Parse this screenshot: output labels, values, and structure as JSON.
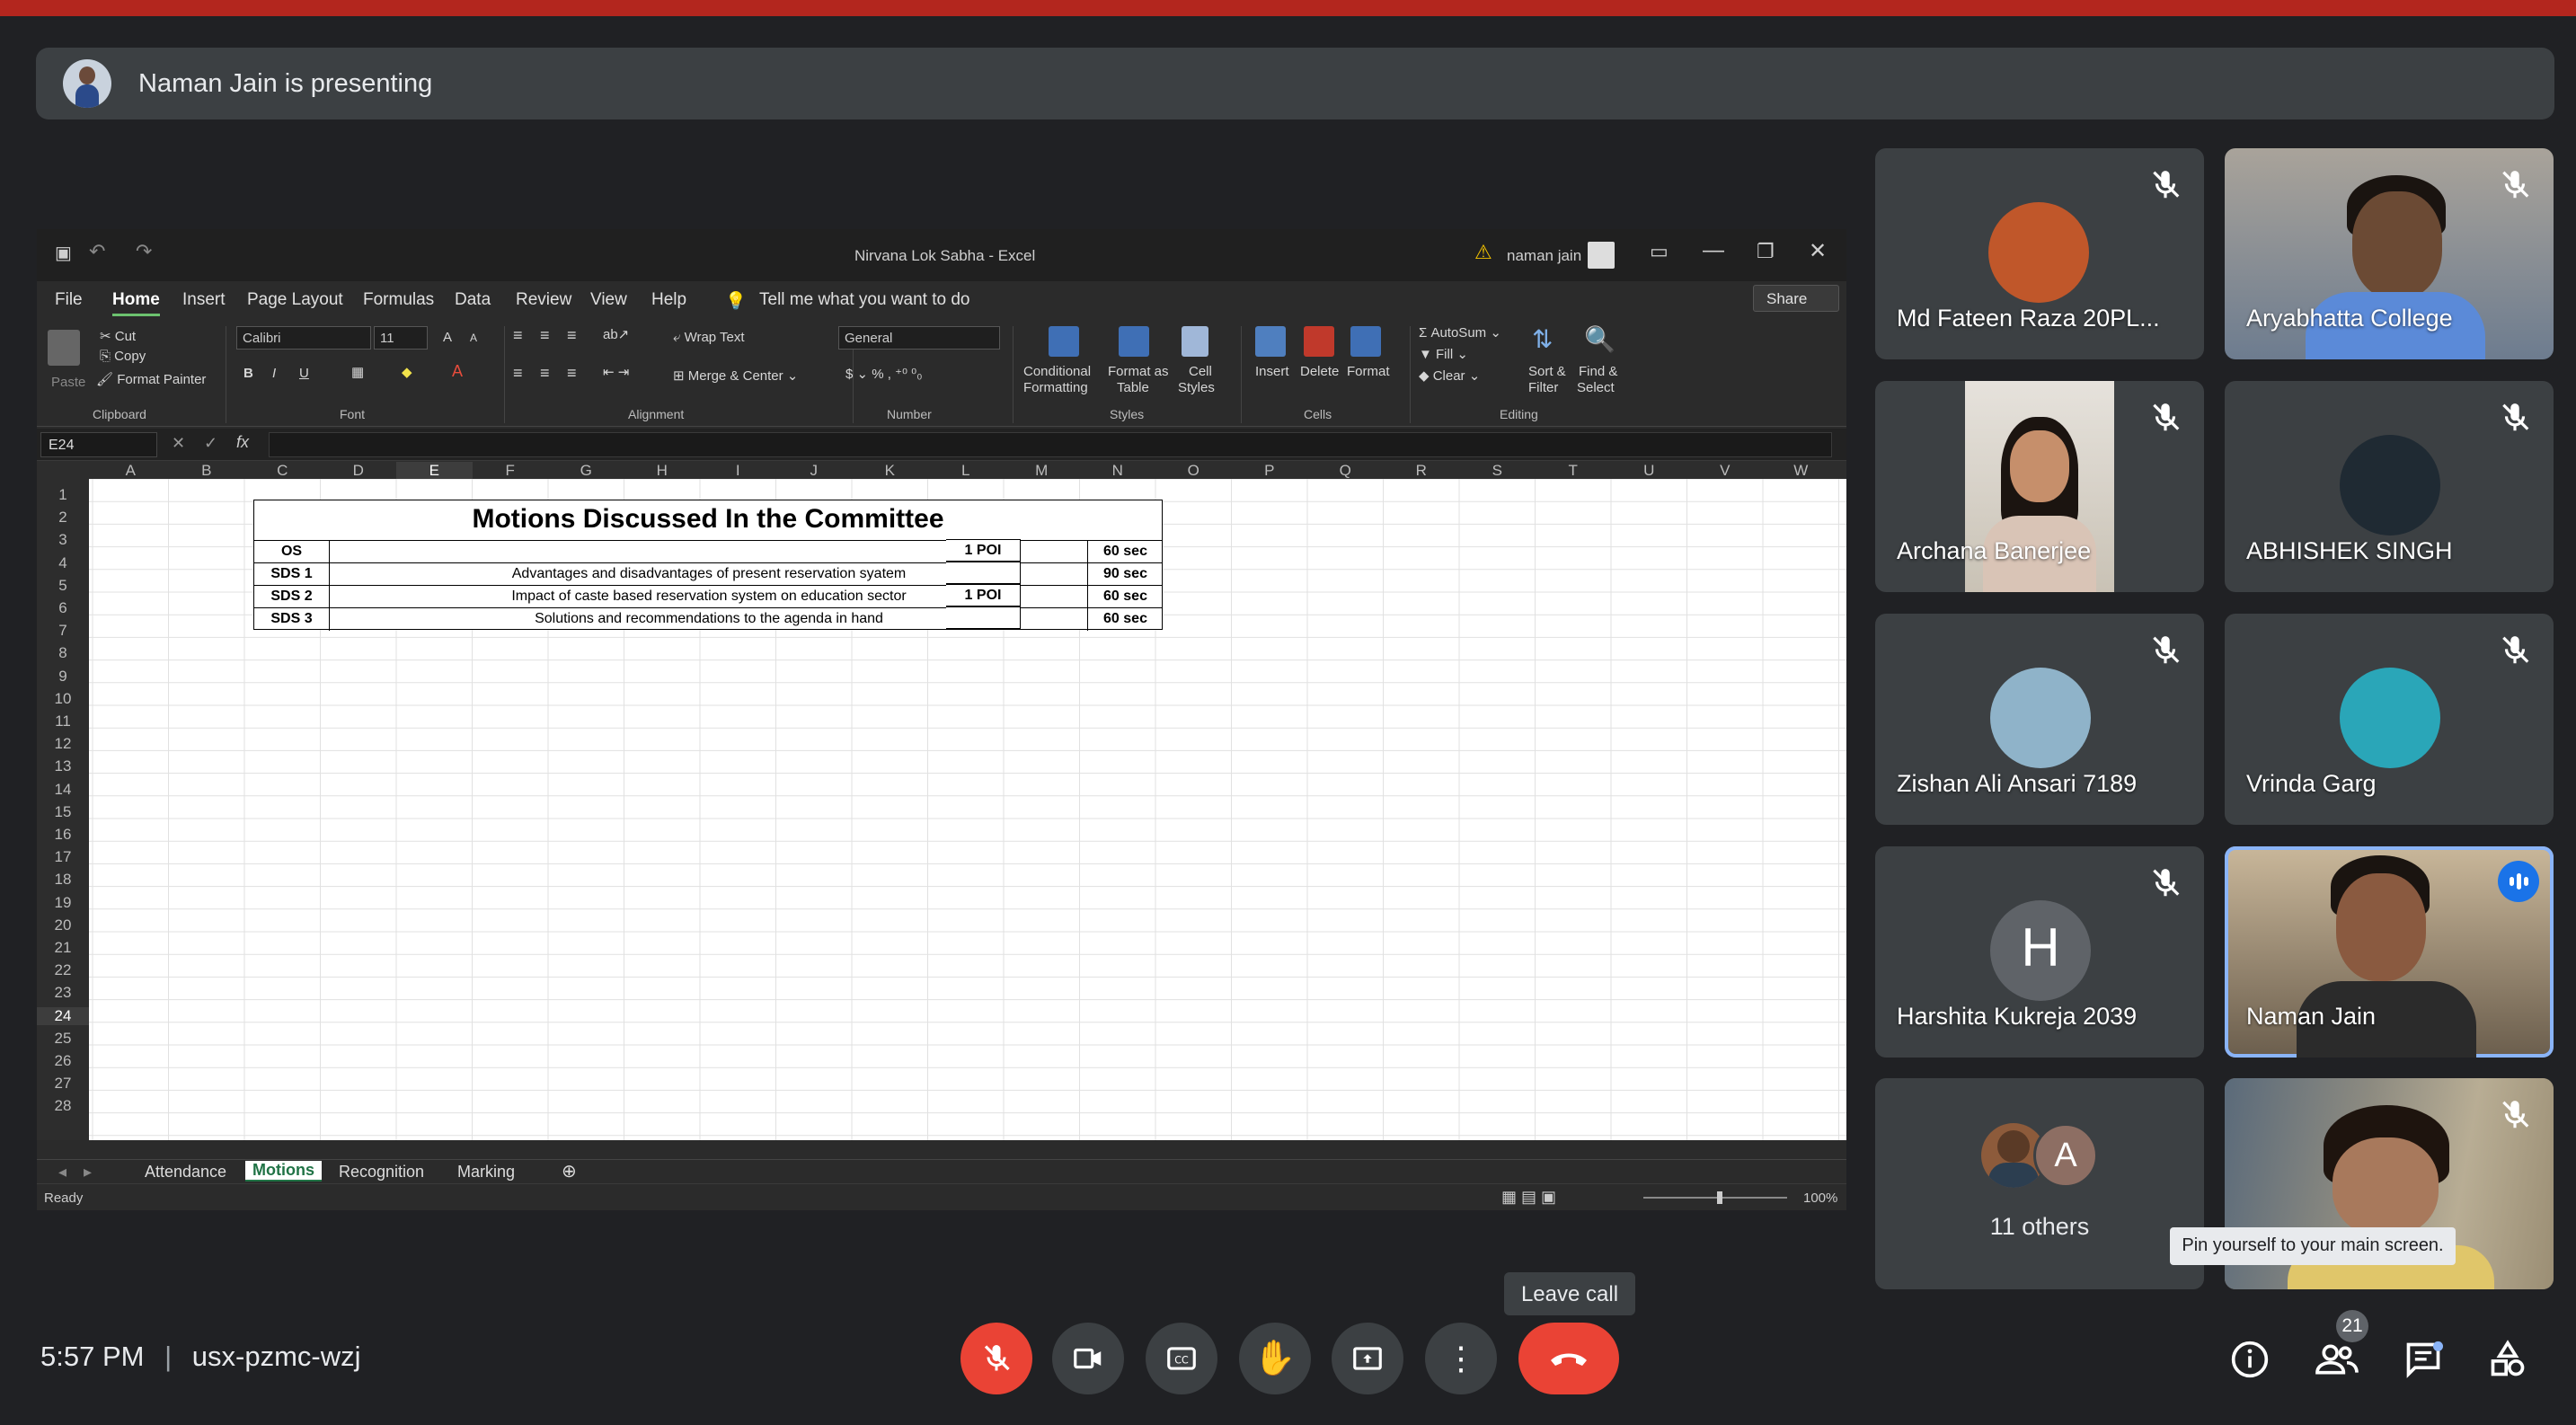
{
  "banner": {
    "presenter_text": "Naman Jain is presenting"
  },
  "excel": {
    "doc_title": "Nirvana Lok Sabha  -  Excel",
    "user": "naman jain",
    "menu": [
      "File",
      "Home",
      "Insert",
      "Page Layout",
      "Formulas",
      "Data",
      "Review",
      "View",
      "Help"
    ],
    "tell_me": "Tell me what you want to do",
    "share": "Share",
    "clipboard": {
      "paste": "Paste",
      "cut": "Cut",
      "copy": "Copy",
      "format_painter": "Format Painter",
      "group": "Clipboard"
    },
    "font": {
      "name": "Calibri",
      "size": "11",
      "group": "Font"
    },
    "alignment": {
      "wrap": "Wrap Text",
      "merge": "Merge & Center",
      "group": "Alignment"
    },
    "number": {
      "format": "General",
      "group": "Number"
    },
    "styles": {
      "cond": "Conditional",
      "cond2": "Formatting",
      "fmt_table": "Format as",
      "fmt_table2": "Table",
      "cell": "Cell",
      "cell2": "Styles",
      "group": "Styles"
    },
    "cells": {
      "insert": "Insert",
      "delete": "Delete",
      "format": "Format",
      "group": "Cells"
    },
    "editing": {
      "autosum": "AutoSum",
      "fill": "Fill",
      "clear": "Clear",
      "sort": "Sort &",
      "sort2": "Filter",
      "find": "Find &",
      "find2": "Select",
      "group": "Editing"
    },
    "name_box": "E24",
    "columns": [
      "A",
      "B",
      "C",
      "D",
      "E",
      "F",
      "G",
      "H",
      "I",
      "J",
      "K",
      "L",
      "M",
      "N",
      "O",
      "P",
      "Q",
      "R",
      "S",
      "T",
      "U",
      "V",
      "W"
    ],
    "rows": [
      "1",
      "2",
      "3",
      "4",
      "5",
      "6",
      "7",
      "8",
      "9",
      "10",
      "11",
      "12",
      "13",
      "14",
      "15",
      "16",
      "17",
      "18",
      "19",
      "20",
      "21",
      "22",
      "23",
      "24",
      "25",
      "26",
      "27",
      "28"
    ],
    "table": {
      "title": "Motions Discussed In the Committee",
      "rows": [
        {
          "code": "OS",
          "desc": "",
          "time": "60 sec",
          "poi": "1 POI"
        },
        {
          "code": "SDS 1",
          "desc": "Advantages and disadvantages of present reservation syatem",
          "time": "90 sec",
          "poi": ""
        },
        {
          "code": "SDS 2",
          "desc": "Impact of caste based reservation system on education sector",
          "time": "60 sec",
          "poi": "1 POI"
        },
        {
          "code": "SDS 3",
          "desc": "Solutions and recommendations to the agenda in hand",
          "time": "60 sec",
          "poi": ""
        }
      ]
    },
    "sheets": [
      "Attendance",
      "Motions",
      "Recognition",
      "Marking"
    ],
    "status": "Ready",
    "zoom": "100%"
  },
  "participants": [
    {
      "name": "Md Fateen Raza 20PL...",
      "muted": true
    },
    {
      "name": "Aryabhatta College",
      "muted": true
    },
    {
      "name": "Archana Banerjee",
      "muted": true
    },
    {
      "name": "ABHISHEK SINGH",
      "muted": true
    },
    {
      "name": "Zishan Ali Ansari 7189",
      "muted": true
    },
    {
      "name": "Vrinda Garg",
      "muted": true
    },
    {
      "name": "Harshita Kukreja 2039",
      "muted": true,
      "initial": "H"
    },
    {
      "name": "Naman Jain",
      "muted": false
    }
  ],
  "others": {
    "label": "11 others",
    "initial": "A"
  },
  "self_tile": {
    "tooltip": "Pin yourself to your main screen."
  },
  "bottom": {
    "time": "5:57 PM",
    "separator": "|",
    "meeting_code": "usx-pzmc-wzj",
    "leave_tooltip": "Leave call",
    "people_count": "21"
  },
  "colors": {
    "bg": "#202124",
    "tile": "#3c4043",
    "red": "#ea4335",
    "excel_green": "#217346",
    "active_outline": "#8ab4f8"
  }
}
